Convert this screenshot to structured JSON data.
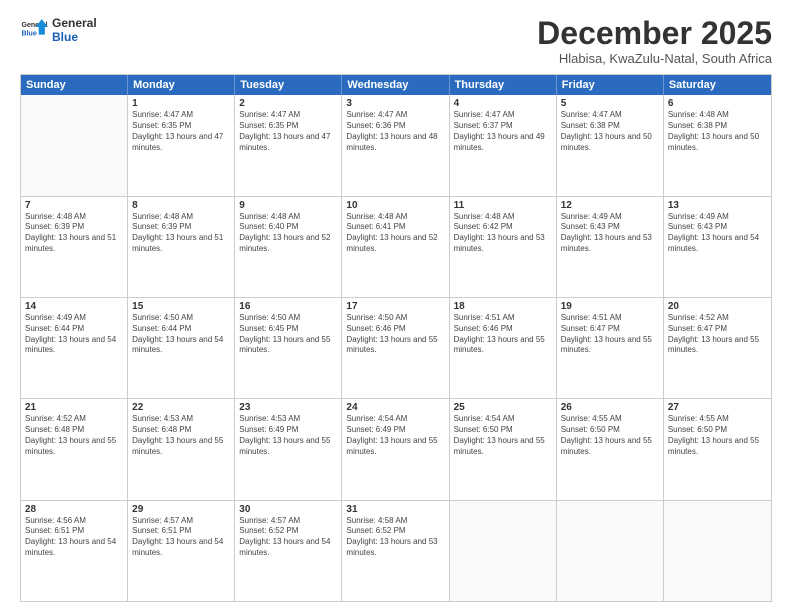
{
  "logo": {
    "general": "General",
    "blue": "Blue"
  },
  "title": "December 2025",
  "location": "Hlabisa, KwaZulu-Natal, South Africa",
  "header_days": [
    "Sunday",
    "Monday",
    "Tuesday",
    "Wednesday",
    "Thursday",
    "Friday",
    "Saturday"
  ],
  "weeks": [
    [
      {
        "day": "",
        "sunrise": "",
        "sunset": "",
        "daylight": ""
      },
      {
        "day": "1",
        "sunrise": "Sunrise: 4:47 AM",
        "sunset": "Sunset: 6:35 PM",
        "daylight": "Daylight: 13 hours and 47 minutes."
      },
      {
        "day": "2",
        "sunrise": "Sunrise: 4:47 AM",
        "sunset": "Sunset: 6:35 PM",
        "daylight": "Daylight: 13 hours and 47 minutes."
      },
      {
        "day": "3",
        "sunrise": "Sunrise: 4:47 AM",
        "sunset": "Sunset: 6:36 PM",
        "daylight": "Daylight: 13 hours and 48 minutes."
      },
      {
        "day": "4",
        "sunrise": "Sunrise: 4:47 AM",
        "sunset": "Sunset: 6:37 PM",
        "daylight": "Daylight: 13 hours and 49 minutes."
      },
      {
        "day": "5",
        "sunrise": "Sunrise: 4:47 AM",
        "sunset": "Sunset: 6:38 PM",
        "daylight": "Daylight: 13 hours and 50 minutes."
      },
      {
        "day": "6",
        "sunrise": "Sunrise: 4:48 AM",
        "sunset": "Sunset: 6:38 PM",
        "daylight": "Daylight: 13 hours and 50 minutes."
      }
    ],
    [
      {
        "day": "7",
        "sunrise": "Sunrise: 4:48 AM",
        "sunset": "Sunset: 6:39 PM",
        "daylight": "Daylight: 13 hours and 51 minutes."
      },
      {
        "day": "8",
        "sunrise": "Sunrise: 4:48 AM",
        "sunset": "Sunset: 6:39 PM",
        "daylight": "Daylight: 13 hours and 51 minutes."
      },
      {
        "day": "9",
        "sunrise": "Sunrise: 4:48 AM",
        "sunset": "Sunset: 6:40 PM",
        "daylight": "Daylight: 13 hours and 52 minutes."
      },
      {
        "day": "10",
        "sunrise": "Sunrise: 4:48 AM",
        "sunset": "Sunset: 6:41 PM",
        "daylight": "Daylight: 13 hours and 52 minutes."
      },
      {
        "day": "11",
        "sunrise": "Sunrise: 4:48 AM",
        "sunset": "Sunset: 6:42 PM",
        "daylight": "Daylight: 13 hours and 53 minutes."
      },
      {
        "day": "12",
        "sunrise": "Sunrise: 4:49 AM",
        "sunset": "Sunset: 6:43 PM",
        "daylight": "Daylight: 13 hours and 53 minutes."
      },
      {
        "day": "13",
        "sunrise": "Sunrise: 4:49 AM",
        "sunset": "Sunset: 6:43 PM",
        "daylight": "Daylight: 13 hours and 54 minutes."
      }
    ],
    [
      {
        "day": "14",
        "sunrise": "Sunrise: 4:49 AM",
        "sunset": "Sunset: 6:44 PM",
        "daylight": "Daylight: 13 hours and 54 minutes."
      },
      {
        "day": "15",
        "sunrise": "Sunrise: 4:50 AM",
        "sunset": "Sunset: 6:44 PM",
        "daylight": "Daylight: 13 hours and 54 minutes."
      },
      {
        "day": "16",
        "sunrise": "Sunrise: 4:50 AM",
        "sunset": "Sunset: 6:45 PM",
        "daylight": "Daylight: 13 hours and 55 minutes."
      },
      {
        "day": "17",
        "sunrise": "Sunrise: 4:50 AM",
        "sunset": "Sunset: 6:46 PM",
        "daylight": "Daylight: 13 hours and 55 minutes."
      },
      {
        "day": "18",
        "sunrise": "Sunrise: 4:51 AM",
        "sunset": "Sunset: 6:46 PM",
        "daylight": "Daylight: 13 hours and 55 minutes."
      },
      {
        "day": "19",
        "sunrise": "Sunrise: 4:51 AM",
        "sunset": "Sunset: 6:47 PM",
        "daylight": "Daylight: 13 hours and 55 minutes."
      },
      {
        "day": "20",
        "sunrise": "Sunrise: 4:52 AM",
        "sunset": "Sunset: 6:47 PM",
        "daylight": "Daylight: 13 hours and 55 minutes."
      }
    ],
    [
      {
        "day": "21",
        "sunrise": "Sunrise: 4:52 AM",
        "sunset": "Sunset: 6:48 PM",
        "daylight": "Daylight: 13 hours and 55 minutes."
      },
      {
        "day": "22",
        "sunrise": "Sunrise: 4:53 AM",
        "sunset": "Sunset: 6:48 PM",
        "daylight": "Daylight: 13 hours and 55 minutes."
      },
      {
        "day": "23",
        "sunrise": "Sunrise: 4:53 AM",
        "sunset": "Sunset: 6:49 PM",
        "daylight": "Daylight: 13 hours and 55 minutes."
      },
      {
        "day": "24",
        "sunrise": "Sunrise: 4:54 AM",
        "sunset": "Sunset: 6:49 PM",
        "daylight": "Daylight: 13 hours and 55 minutes."
      },
      {
        "day": "25",
        "sunrise": "Sunrise: 4:54 AM",
        "sunset": "Sunset: 6:50 PM",
        "daylight": "Daylight: 13 hours and 55 minutes."
      },
      {
        "day": "26",
        "sunrise": "Sunrise: 4:55 AM",
        "sunset": "Sunset: 6:50 PM",
        "daylight": "Daylight: 13 hours and 55 minutes."
      },
      {
        "day": "27",
        "sunrise": "Sunrise: 4:55 AM",
        "sunset": "Sunset: 6:50 PM",
        "daylight": "Daylight: 13 hours and 55 minutes."
      }
    ],
    [
      {
        "day": "28",
        "sunrise": "Sunrise: 4:56 AM",
        "sunset": "Sunset: 6:51 PM",
        "daylight": "Daylight: 13 hours and 54 minutes."
      },
      {
        "day": "29",
        "sunrise": "Sunrise: 4:57 AM",
        "sunset": "Sunset: 6:51 PM",
        "daylight": "Daylight: 13 hours and 54 minutes."
      },
      {
        "day": "30",
        "sunrise": "Sunrise: 4:57 AM",
        "sunset": "Sunset: 6:52 PM",
        "daylight": "Daylight: 13 hours and 54 minutes."
      },
      {
        "day": "31",
        "sunrise": "Sunrise: 4:58 AM",
        "sunset": "Sunset: 6:52 PM",
        "daylight": "Daylight: 13 hours and 53 minutes."
      },
      {
        "day": "",
        "sunrise": "",
        "sunset": "",
        "daylight": ""
      },
      {
        "day": "",
        "sunrise": "",
        "sunset": "",
        "daylight": ""
      },
      {
        "day": "",
        "sunrise": "",
        "sunset": "",
        "daylight": ""
      }
    ]
  ]
}
